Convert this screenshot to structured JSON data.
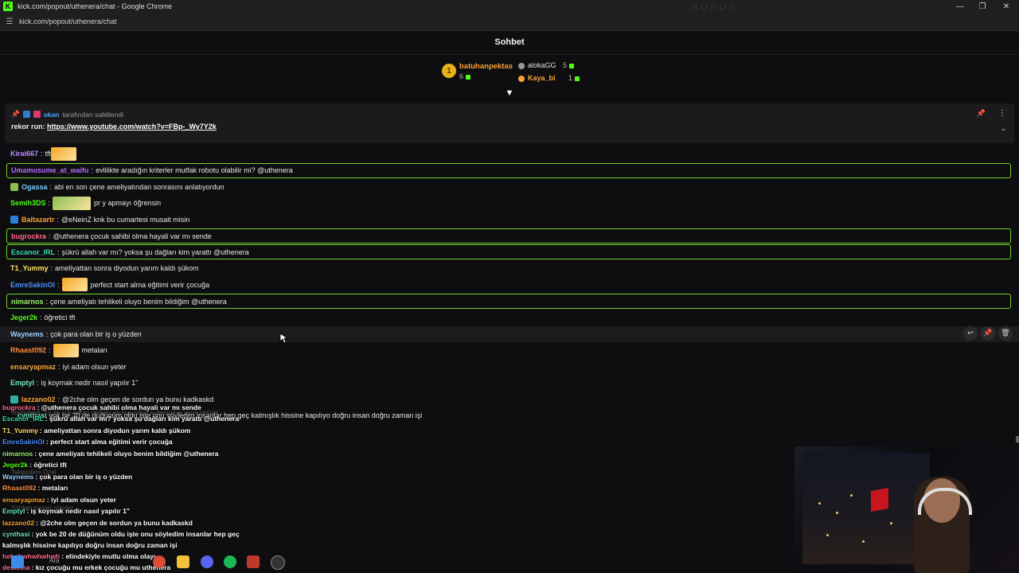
{
  "window": {
    "title": "kick.com/popout/uthenera/chat - Google Chrome",
    "brand_watermark": "AORUS",
    "url": "kick.com/popout/uthenera/chat"
  },
  "chat": {
    "header": "Sohbet",
    "leaderboard": {
      "first": {
        "rank": "1",
        "name": "batuhanpektas",
        "count": "6"
      },
      "others": [
        {
          "name": "alokaGG",
          "count": "5",
          "color": "#e0e0e0"
        },
        {
          "name": "Kaya_bi",
          "count": "1",
          "color": "#f7a335"
        }
      ]
    },
    "pinned": {
      "pinner": "okan",
      "pinned_by_text": "tarafından sabitlendi",
      "message_prefix": "rekor run:",
      "link": "https://www.youtube.com/watch?v=FBp-_Wy7Y2k"
    },
    "messages": [
      {
        "user": "Kirai667",
        "color": "#c08bff",
        "text": "tft",
        "emote": true
      },
      {
        "user": "Umamusume_at_waifu",
        "color": "#b56cff",
        "text": "evlilikte aradığın kriterler mutfak robotu olabilir mi? @uthenera",
        "mention": true
      },
      {
        "user": "Ogassa",
        "color": "#79c9ff",
        "text": "abi en son çene ameliyatından sonrasını anlatıyordun"
      },
      {
        "user": "Semih3DS",
        "color": "#53fc18",
        "text": "pr y apmayı öğrensin",
        "emote": true
      },
      {
        "user": "Baltazartr",
        "color": "#f7a335",
        "text": "@eNeinZ knk bu cumartesi musait misin"
      },
      {
        "user": "bugrockra",
        "color": "#ff6b8a",
        "text": "@uthenera çocuk sahibi olma hayali var mı sende",
        "mention": true
      },
      {
        "user": "Escanor_IRL",
        "color": "#38d9a9",
        "text": "şükrü allah var mı? yoksa şu dağları kim yarattı @uthenera",
        "mention": true
      },
      {
        "user": "T1_Yummy",
        "color": "#ffe066",
        "text": "ameliyattan sonra diyodun yarım kaldı şükom"
      },
      {
        "user": "EmreSakinOl",
        "color": "#4a8dff",
        "text": "perfect start alma eğitimi verir çocuğa",
        "emote": true
      },
      {
        "user": "nimarnos",
        "color": "#9bf06b",
        "text": "çene ameliyatı tehlikeli oluyo benim bildiğim @uthenera",
        "mention": true
      },
      {
        "user": "Jeger2k",
        "color": "#53fc18",
        "text": "öğretici tft"
      },
      {
        "user": "Waynems",
        "color": "#9ad0ff",
        "text": "çok para olan bir iş o yüzden",
        "hovered": true
      },
      {
        "user": "Rhaast092",
        "color": "#ff8c42",
        "text": "metaları",
        "emote": true
      },
      {
        "user": "ensaryapmaz",
        "color": "#f7a335",
        "text": "iyi adam olsun yeter"
      },
      {
        "user": "Emptyl",
        "color": "#6ee7b7",
        "text": "iş koymak nedir nasıl yapılır 1\""
      },
      {
        "user": "lazzano02",
        "color": "#f7a335",
        "text": "@2che olm geçen de sordun ya bunu kadkaskd"
      }
    ],
    "extra_line": "yok be 20 de düğünüm oldu işte onu söyledim insanlar hep geç kalmışlık hissine kapılıyo doğru insan doğru zaman işi",
    "extra_user": "cynthasi"
  },
  "overlay": {
    "ghost_lines": [
      "fexthebest: 19 da çok erken değilmi ya krai şimdi kullanıcaya yanıt veriyor",
      "Takipçilere Özel",
      "Sohbet mesajı gönder..."
    ],
    "lines": [
      {
        "user": "bugrockra",
        "color": "#ff6b8a",
        "text": "@uthenera çocuk sahibi olma hayali var mı sende"
      },
      {
        "user": "Escanor_IRL",
        "color": "#38d9a9",
        "text": "şükrü allah var mı? yoksa şu dağları kim yarattı @uthenera"
      },
      {
        "user": "T1_Yummy",
        "color": "#ffe066",
        "text": "ameliyattan sonra diyodun yarım kaldı şükom"
      },
      {
        "user": "EmreSakinOl",
        "color": "#4a8dff",
        "text": "perfect start alma eğitimi verir çocuğa"
      },
      {
        "user": "nimarnos",
        "color": "#9bf06b",
        "text": "çene ameliyatı tehlikeli oluyo benim bildiğim @uthenera"
      },
      {
        "user": "Jeger2k",
        "color": "#53fc18",
        "text": "öğretici tft"
      },
      {
        "user": "Waynems",
        "color": "#9ad0ff",
        "text": "çok para olan bir iş o yüzden"
      },
      {
        "user": "Rhaast092",
        "color": "#ff8c42",
        "text": "metaları"
      },
      {
        "user": "ensaryapmaz",
        "color": "#f7a335",
        "text": "iyi adam olsun yeter"
      },
      {
        "user": "Emptyl",
        "color": "#6ee7b7",
        "text": "iş koymak nedir nasıl yapılır 1\""
      },
      {
        "user": "lazzano02",
        "color": "#f7a335",
        "text": "@2che olm geçen de sordun ya bunu kadkaskd"
      },
      {
        "user": "cynthasi",
        "color": "#6ee7b7",
        "text": "yok be 20 de düğünüm oldu işte onu söyledim insanlar hep geç"
      },
      {
        "user": "",
        "color": "#ffffff",
        "text": "kalmışlık hissine kapılıyo doğru insan doğru zaman işi"
      },
      {
        "user": "hebehwhwhwhwh",
        "color": "#ff6b8a",
        "text": "elindekiyle mutlu olma olayı"
      },
      {
        "user": "desteina",
        "color": "#ff6b8a",
        "text": "kız çocuğu mu erkek çocuğu mu uthenera"
      }
    ],
    "taskbar_search": "Ara"
  }
}
